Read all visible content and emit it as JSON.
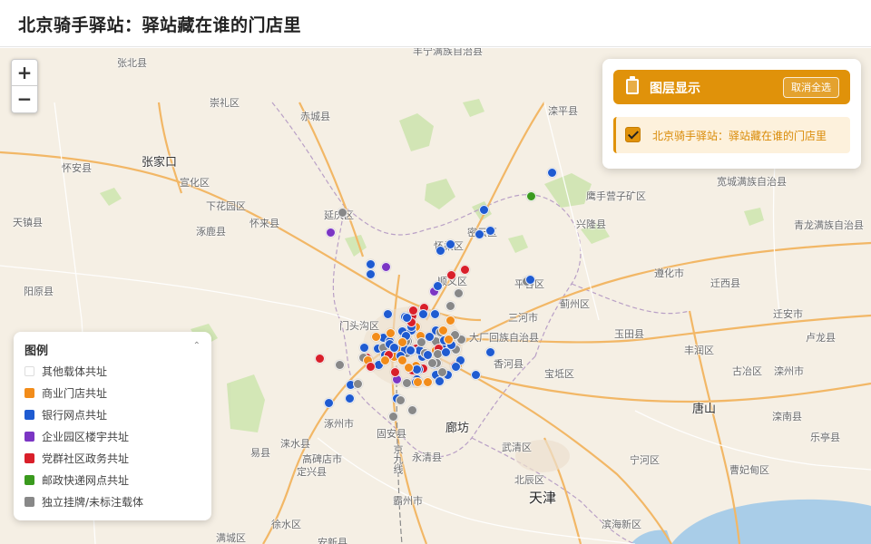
{
  "page": {
    "title": "北京骑手驿站：驿站藏在谁的门店里"
  },
  "zoom": {
    "in_label": "+",
    "out_label": "−"
  },
  "layer_panel": {
    "title": "图层显示",
    "deselect_all_label": "取消全选",
    "layers": [
      {
        "name": "北京骑手驿站：驿站藏在谁的门店里",
        "checked": true
      }
    ]
  },
  "legend": {
    "title": "图例",
    "items": [
      {
        "label": "其他载体共址",
        "color": "#ffffff"
      },
      {
        "label": "商业门店共址",
        "color": "#f28c1a"
      },
      {
        "label": "银行网点共址",
        "color": "#1f5bd1"
      },
      {
        "label": "企业园区楼宇共址",
        "color": "#7b35c4"
      },
      {
        "label": "党群社区政务共址",
        "color": "#d91f2a"
      },
      {
        "label": "邮政快递网点共址",
        "color": "#3a9a1e"
      },
      {
        "label": "独立挂牌/未标注载体",
        "color": "#888888"
      }
    ]
  },
  "map_labels": [
    "丰宁满族自治县",
    "张北县",
    "崇礼区",
    "赤城县",
    "滦平县",
    "张家口",
    "怀安县",
    "宣化区",
    "下花园区",
    "怀来县",
    "延庆区",
    "宽城满族自治县",
    "鹰手营子矿区",
    "兴隆县",
    "天镇县",
    "涿鹿县",
    "青龙满族自治县",
    "阳原县",
    "怀柔区",
    "密云区",
    "顺义区",
    "平谷区",
    "遵化市",
    "迁西县",
    "蓟州区",
    "门头沟区",
    "三河市",
    "玉田县",
    "迁安市",
    "大厂回族自治县",
    "丰润区",
    "卢龙县",
    "香河县",
    "宝坻区",
    "古冶区",
    "滦州市",
    "唐山",
    "涿州市",
    "廊坊",
    "滦南县",
    "固安县",
    "易县",
    "涞水县",
    "高碑店市",
    "永清县",
    "武清区",
    "宁河区",
    "乐亭县",
    "定兴县",
    "曹妃甸区",
    "北辰区",
    "霸州市",
    "天津",
    "徐水区",
    "滨海新区",
    "安新县",
    "满城区",
    "京九线"
  ],
  "marker_colors": {
    "commercial": "#f28c1a",
    "bank": "#1f5bd1",
    "enterprise": "#7b35c4",
    "party": "#d91f2a",
    "post": "#3a9a1e",
    "independent": "#888888"
  }
}
